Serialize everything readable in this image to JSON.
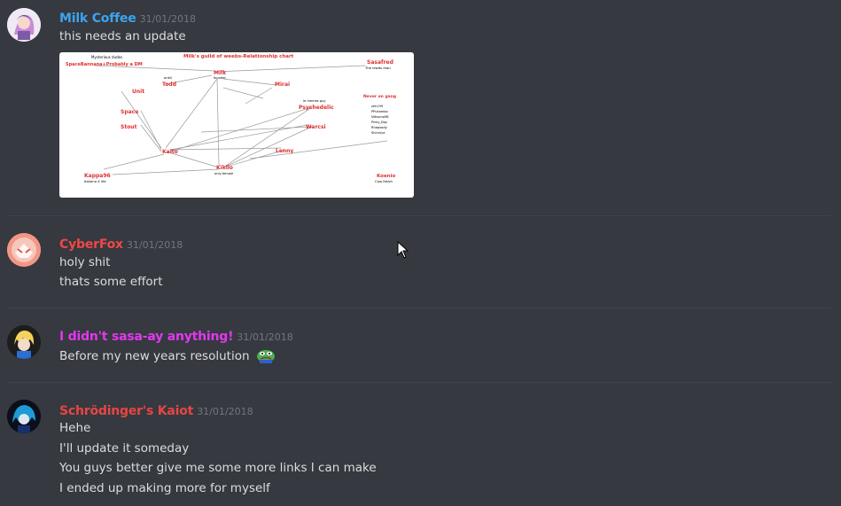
{
  "messages": [
    {
      "author": "Milk Coffee",
      "author_color": "#3ca4f0",
      "timestamp": "31/01/2018",
      "lines": [
        "this needs an update"
      ],
      "attachment": {
        "title": "Milk's guild of weebs-Relationship chart",
        "nodes": {
          "mysterious_dudes": "Mysterious dudes",
          "spacebannana": "SpaceBannana+Probably a DM",
          "milk": "Milk",
          "milk_sub": "founder",
          "sasafred": "Sasafred",
          "sasafred_sub": "The lewds man",
          "unit": "Unit",
          "todd": "Todd",
          "todd_pre": "ankii",
          "mirai": "Mirai",
          "space": "Space",
          "stout": "Stout",
          "psychedelic": "Psychedelic",
          "psychedelic_pre": "le memes guy",
          "warcsi": "Warcsi",
          "lenny": "Lenny",
          "kaito": "Kaito",
          "kikilo": "Kikilo",
          "kikilo_sub": "only-female",
          "kappa96": "Kappa96",
          "kappa96_sub": "Italiano 4 life",
          "never_on": "Never on gang",
          "koenio": "Koenio",
          "koenio_sub": "Cow fetish"
        },
        "never_on_list": [
          "zeh199",
          "PPukambo",
          "Nitsuma98",
          "Pinky_Boy",
          "Rhapsody",
          "Shinniya"
        ]
      }
    },
    {
      "author": "CyberFox",
      "author_color": "#f04747",
      "timestamp": "31/01/2018",
      "lines": [
        "holy shit",
        "thats some effort"
      ]
    },
    {
      "author": "I didn't sasa-ay anything!",
      "author_color": "#e337f0",
      "timestamp": "31/01/2018",
      "lines": [
        "Before my new years resolution"
      ]
    },
    {
      "author": "Schrödinger's Kaiot",
      "author_color": "#e84545",
      "timestamp": "31/01/2018",
      "lines": [
        "Hehe",
        "I'll update it someday",
        "You guys better give me some more links I can make",
        "I ended up making more for myself"
      ]
    }
  ],
  "icons": {
    "emoji": "pepe-emoji-icon",
    "cursor": "mouse-cursor-icon"
  }
}
